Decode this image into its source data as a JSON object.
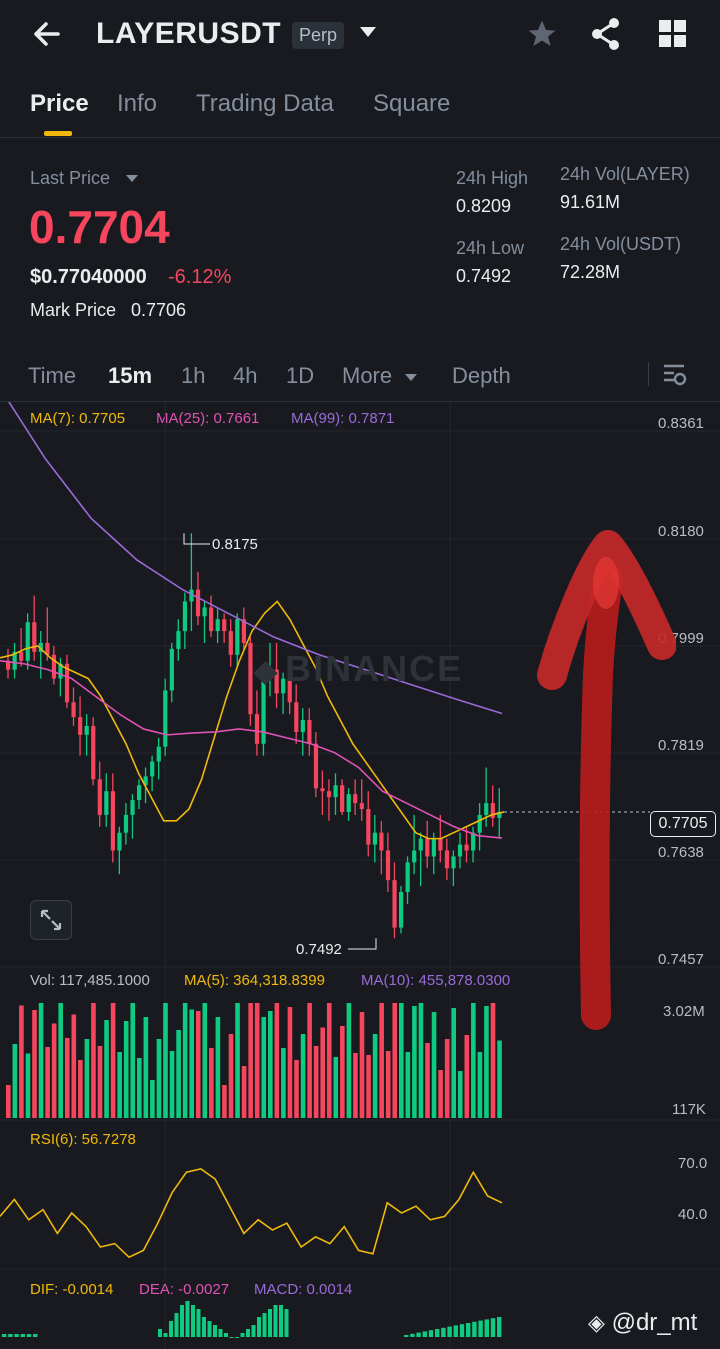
{
  "colors": {
    "bg": "#181a20",
    "up": "#0ecb81",
    "down": "#f6465d",
    "accent": "#f0b90b",
    "ma7": "#f0b90b",
    "ma25": "#e052b4",
    "ma99": "#9a6ad8",
    "arrow": "#c62828"
  },
  "header": {
    "back_icon": "back-arrow-icon",
    "symbol": "LAYERUSDT",
    "badge": "Perp",
    "dropdown_icon": "caret-down-icon",
    "icons": [
      "star-icon",
      "share-icon",
      "grid-icon"
    ]
  },
  "tabs": [
    {
      "label": "Price",
      "active": true
    },
    {
      "label": "Info",
      "active": false
    },
    {
      "label": "Trading Data",
      "active": false
    },
    {
      "label": "Square",
      "active": false
    }
  ],
  "ticker": {
    "last_price_label": "Last Price",
    "last_price": "0.7704",
    "usd_price": "$0.77040000",
    "change": "-6.12%",
    "mark_price_label": "Mark Price",
    "mark_price": "0.7706",
    "high_label": "24h High",
    "high": "0.8209",
    "low_label": "24h Low",
    "low": "0.7492",
    "vol_base_label": "24h Vol(LAYER)",
    "vol_base": "91.61M",
    "vol_quote_label": "24h Vol(USDT)",
    "vol_quote": "72.28M"
  },
  "timeframes": {
    "items": [
      {
        "label": "Time",
        "active": false
      },
      {
        "label": "15m",
        "active": true
      },
      {
        "label": "1h",
        "active": false
      },
      {
        "label": "4h",
        "active": false
      },
      {
        "label": "1D",
        "active": false
      },
      {
        "label": "More",
        "active": false
      }
    ],
    "depth": "Depth",
    "settings_icon": "chart-settings-icon"
  },
  "indicators": {
    "ma7": "MA(7): 0.7705",
    "ma25": "MA(25): 0.7661",
    "ma99": "MA(99): 0.7871",
    "vol": "Vol: 117,485.1000",
    "vol_ma5": "MA(5): 364,318.8399",
    "vol_ma10": "MA(10): 455,878.0300",
    "rsi": "RSI(6): 56.7278",
    "dif": "DIF: -0.0014",
    "dea": "DEA: -0.0027",
    "macd": "MACD: 0.0014"
  },
  "price_axis": [
    "0.8361",
    "0.8180",
    "0.7999",
    "0.7819",
    "0.7638",
    "0.7457"
  ],
  "current_price_tag": "0.7705",
  "high_marker": "0.8175",
  "low_marker": "0.7492",
  "watermark": "BINANCE",
  "vol_axis": {
    "top": "3.02M",
    "bottom": "117K"
  },
  "rsi_axis": {
    "upper": "70.0",
    "lower": "40.0"
  },
  "user_tag": "@dr_mt",
  "chart_data": {
    "type": "candlestick",
    "interval": "15m",
    "ylim": [
      0.7457,
      0.8361
    ],
    "candles": [
      [
        0.796,
        0.798,
        0.793,
        0.7945
      ],
      [
        0.7945,
        0.799,
        0.793,
        0.7975
      ],
      [
        0.7975,
        0.8015,
        0.795,
        0.796
      ],
      [
        0.796,
        0.804,
        0.7945,
        0.8025
      ],
      [
        0.8025,
        0.807,
        0.796,
        0.7975
      ],
      [
        0.7975,
        0.801,
        0.793,
        0.799
      ],
      [
        0.799,
        0.805,
        0.796,
        0.797
      ],
      [
        0.797,
        0.7985,
        0.792,
        0.793
      ],
      [
        0.793,
        0.7965,
        0.79,
        0.7955
      ],
      [
        0.7955,
        0.797,
        0.788,
        0.789
      ],
      [
        0.789,
        0.7915,
        0.785,
        0.7865
      ],
      [
        0.7865,
        0.79,
        0.78,
        0.7835
      ],
      [
        0.7835,
        0.787,
        0.78,
        0.785
      ],
      [
        0.785,
        0.7865,
        0.775,
        0.776
      ],
      [
        0.776,
        0.779,
        0.768,
        0.77
      ],
      [
        0.77,
        0.777,
        0.768,
        0.774
      ],
      [
        0.774,
        0.777,
        0.762,
        0.764
      ],
      [
        0.764,
        0.768,
        0.76,
        0.767
      ],
      [
        0.767,
        0.772,
        0.765,
        0.77
      ],
      [
        0.77,
        0.7735,
        0.766,
        0.7725
      ],
      [
        0.7725,
        0.776,
        0.771,
        0.775
      ],
      [
        0.775,
        0.778,
        0.772,
        0.7765
      ],
      [
        0.7765,
        0.78,
        0.774,
        0.779
      ],
      [
        0.779,
        0.783,
        0.776,
        0.7815
      ],
      [
        0.7815,
        0.793,
        0.78,
        0.791
      ],
      [
        0.791,
        0.799,
        0.789,
        0.798
      ],
      [
        0.798,
        0.803,
        0.796,
        0.801
      ],
      [
        0.801,
        0.8075,
        0.798,
        0.806
      ],
      [
        0.806,
        0.8175,
        0.801,
        0.808
      ],
      [
        0.808,
        0.811,
        0.802,
        0.8035
      ],
      [
        0.8035,
        0.806,
        0.799,
        0.805
      ],
      [
        0.805,
        0.807,
        0.8,
        0.801
      ],
      [
        0.801,
        0.805,
        0.799,
        0.803
      ],
      [
        0.803,
        0.804,
        0.799,
        0.801
      ],
      [
        0.801,
        0.803,
        0.795,
        0.797
      ],
      [
        0.797,
        0.804,
        0.795,
        0.803
      ],
      [
        0.803,
        0.805,
        0.798,
        0.799
      ],
      [
        0.799,
        0.8,
        0.785,
        0.787
      ],
      [
        0.787,
        0.791,
        0.78,
        0.782
      ],
      [
        0.782,
        0.795,
        0.78,
        0.793
      ],
      [
        0.793,
        0.799,
        0.79,
        0.7945
      ],
      [
        0.7945,
        0.799,
        0.788,
        0.7905
      ],
      [
        0.7905,
        0.794,
        0.787,
        0.793
      ],
      [
        0.793,
        0.795,
        0.787,
        0.789
      ],
      [
        0.789,
        0.792,
        0.782,
        0.784
      ],
      [
        0.784,
        0.788,
        0.78,
        0.786
      ],
      [
        0.786,
        0.788,
        0.78,
        0.782
      ],
      [
        0.782,
        0.784,
        0.773,
        0.7745
      ],
      [
        0.7745,
        0.7775,
        0.77,
        0.774
      ],
      [
        0.774,
        0.776,
        0.769,
        0.773
      ],
      [
        0.773,
        0.777,
        0.77,
        0.775
      ],
      [
        0.775,
        0.776,
        0.77,
        0.7705
      ],
      [
        0.7705,
        0.7745,
        0.769,
        0.7735
      ],
      [
        0.7735,
        0.776,
        0.77,
        0.772
      ],
      [
        0.772,
        0.776,
        0.769,
        0.771
      ],
      [
        0.771,
        0.774,
        0.763,
        0.765
      ],
      [
        0.765,
        0.77,
        0.762,
        0.767
      ],
      [
        0.767,
        0.769,
        0.76,
        0.764
      ],
      [
        0.764,
        0.767,
        0.757,
        0.759
      ],
      [
        0.759,
        0.762,
        0.7492,
        0.751
      ],
      [
        0.751,
        0.758,
        0.75,
        0.757
      ],
      [
        0.757,
        0.763,
        0.755,
        0.762
      ],
      [
        0.762,
        0.77,
        0.76,
        0.764
      ],
      [
        0.764,
        0.767,
        0.758,
        0.766
      ],
      [
        0.766,
        0.769,
        0.761,
        0.763
      ],
      [
        0.763,
        0.767,
        0.76,
        0.766
      ],
      [
        0.766,
        0.77,
        0.762,
        0.764
      ],
      [
        0.764,
        0.766,
        0.759,
        0.761
      ],
      [
        0.761,
        0.764,
        0.758,
        0.763
      ],
      [
        0.763,
        0.767,
        0.761,
        0.765
      ],
      [
        0.765,
        0.768,
        0.762,
        0.764
      ],
      [
        0.764,
        0.768,
        0.762,
        0.767
      ],
      [
        0.767,
        0.772,
        0.764,
        0.77
      ],
      [
        0.77,
        0.778,
        0.768,
        0.772
      ],
      [
        0.772,
        0.775,
        0.768,
        0.7695
      ],
      [
        0.7695,
        0.7745,
        0.766,
        0.7705
      ]
    ],
    "ma7": [
      0.7965,
      0.797,
      0.798,
      0.7985,
      0.7965,
      0.795,
      0.794,
      0.793,
      0.79,
      0.786,
      0.782,
      0.777,
      0.773,
      0.769,
      0.769,
      0.771,
      0.776,
      0.783,
      0.79,
      0.796,
      0.801,
      0.804,
      0.806,
      0.803,
      0.799,
      0.795,
      0.79,
      0.786,
      0.782,
      0.779,
      0.776,
      0.773,
      0.77,
      0.767,
      0.766,
      0.766,
      0.767,
      0.768,
      0.769,
      0.77,
      0.7705
    ],
    "ma25": [
      0.796,
      0.7955,
      0.7945,
      0.793,
      0.79,
      0.787,
      0.7845,
      0.7835,
      0.7838,
      0.784,
      0.7845,
      0.784,
      0.783,
      0.782,
      0.7805,
      0.778,
      0.774,
      0.772,
      0.77,
      0.768,
      0.7665,
      0.7661
    ],
    "ma99": [
      0.842,
      0.83,
      0.82,
      0.813,
      0.808,
      0.804,
      0.8,
      0.797,
      0.7945,
      0.792,
      0.7895,
      0.7871
    ],
    "volume_ma5_line": true,
    "rsi6": [
      48,
      58,
      46,
      52,
      38,
      50,
      42,
      30,
      32,
      24,
      28,
      44,
      62,
      74,
      76,
      70,
      54,
      38,
      46,
      40,
      44,
      30,
      36,
      32,
      42,
      28,
      26,
      56,
      50,
      54,
      46,
      48,
      58,
      74,
      60,
      56
    ],
    "macd_hist": [
      0.0002,
      0.0001,
      0.0004,
      0.0006,
      0.0008,
      0.0009,
      0.0008,
      0.0007,
      0.0005,
      0.0004,
      0.0003,
      0.0002,
      0.0001,
      0.0,
      0.0,
      0.0001,
      0.0002,
      0.0003,
      0.0005,
      0.0006,
      0.0007,
      0.0008,
      0.0008,
      0.0007
    ]
  }
}
